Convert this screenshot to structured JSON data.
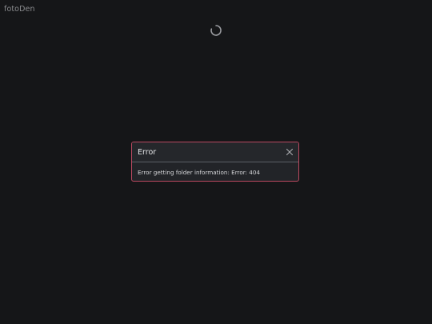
{
  "app": {
    "brand": "fotoDen"
  },
  "loading": {
    "icon": "spinner-icon"
  },
  "toast": {
    "title": "Error",
    "message": "Error getting folder information: Error: 404",
    "close_icon": "close-icon",
    "accent_color": "#b8485f"
  }
}
